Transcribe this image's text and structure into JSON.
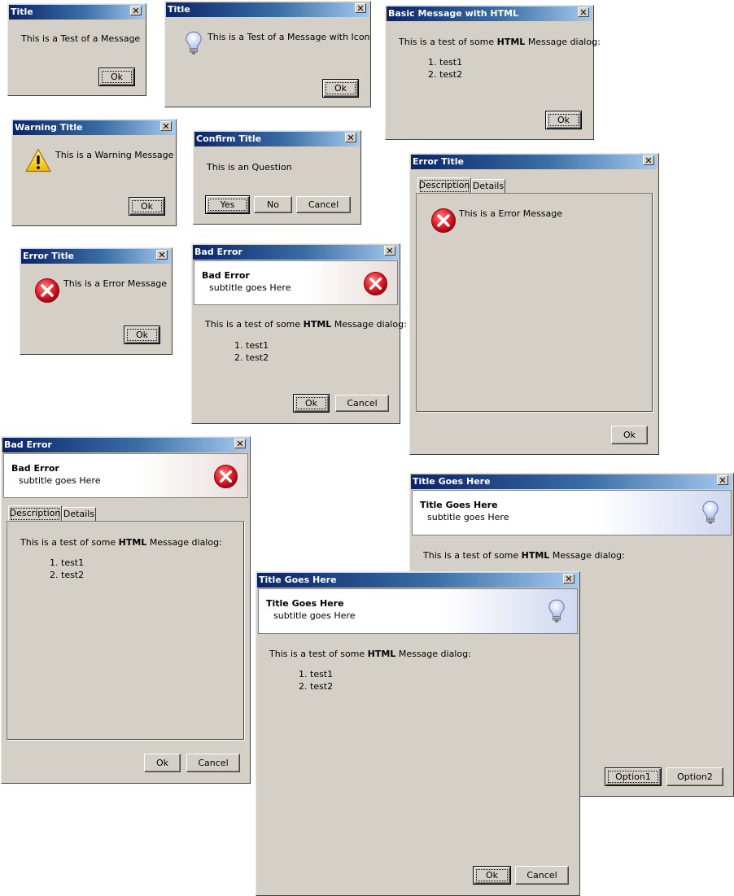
{
  "dialogs": {
    "d1": {
      "title": "Title",
      "message": "This is a Test of a Message",
      "ok": "Ok"
    },
    "d2": {
      "title": "Title",
      "message": "This is a Test of a Message with Icon",
      "ok": "Ok",
      "icon": "lightbulb-icon"
    },
    "d3": {
      "title": "Basic Message with HTML",
      "message_pre": "This is a test of some ",
      "message_bold": "HTML",
      "message_post": " Message dialog:",
      "items": [
        "test1",
        "test2"
      ],
      "ok": "Ok"
    },
    "d4": {
      "title": "Warning Title",
      "message": "This is a Warning Message",
      "ok": "Ok",
      "icon": "warning-icon"
    },
    "d5": {
      "title": "Confirm Title",
      "message": "This is an Question",
      "yes": "Yes",
      "no": "No",
      "cancel": "Cancel"
    },
    "d6": {
      "title": "Error Title",
      "tabs": [
        "Description",
        "Details"
      ],
      "message": "This is a Error Message",
      "ok": "Ok",
      "icon": "error-icon"
    },
    "d7": {
      "title": "Error Title",
      "message": "This is a Error Message",
      "ok": "Ok",
      "icon": "error-icon"
    },
    "d8": {
      "title": "Bad Error",
      "header_title": "Bad Error",
      "header_subtitle": "subtitle goes Here",
      "message_pre": "This is a test of some ",
      "message_bold": "HTML",
      "message_post": " Message dialog:",
      "items": [
        "test1",
        "test2"
      ],
      "ok": "Ok",
      "cancel": "Cancel"
    },
    "d9": {
      "title": "Bad Error",
      "header_title": "Bad Error",
      "header_subtitle": "subtitle goes Here",
      "tabs": [
        "Description",
        "Details"
      ],
      "message_pre": "This is a test of some ",
      "message_bold": "HTML",
      "message_post": " Message dialog:",
      "items": [
        "test1",
        "test2"
      ],
      "ok": "Ok",
      "cancel": "Cancel"
    },
    "d10": {
      "title": "Title Goes Here",
      "header_title": "Title Goes Here",
      "header_subtitle": "subtitle goes Here",
      "message_pre": "This is a test of some ",
      "message_bold": "HTML",
      "message_post": " Message dialog:",
      "option1": "Option1",
      "option2": "Option2"
    },
    "d11": {
      "title": "Title Goes Here",
      "header_title": "Title Goes Here",
      "header_subtitle": "subtitle goes Here",
      "message_pre": "This is a test of some ",
      "message_bold": "HTML",
      "message_post": " Message dialog:",
      "items": [
        "test1",
        "test2"
      ],
      "ok": "Ok",
      "cancel": "Cancel"
    }
  },
  "close_glyph": "✕",
  "colors": {
    "dialog_bg": "#d4d0c8",
    "title_dark": "#0a246a",
    "title_light": "#a6caf0",
    "error_red": "#e0202a",
    "warning_yellow": "#f8d820"
  }
}
